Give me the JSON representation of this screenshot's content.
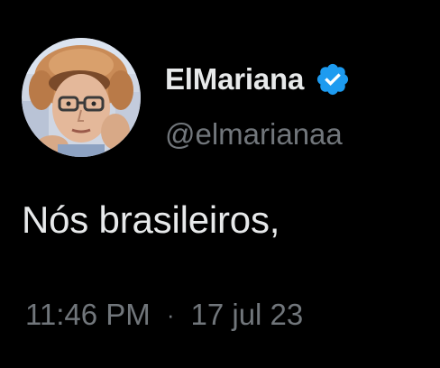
{
  "tweet": {
    "author": {
      "display_name": "ElMariana",
      "handle": "@elmarianaa",
      "verified": true,
      "avatar_icon": "avatar-photo",
      "verified_icon": "verified-badge-icon"
    },
    "text": "Nós brasileiros,",
    "time": "11:46 PM",
    "separator": "·",
    "date": "17 jul 23"
  },
  "colors": {
    "background": "#000000",
    "primary_text": "#e7e9ea",
    "secondary_text": "#71767b",
    "verified_badge": "#1d9bf0"
  }
}
